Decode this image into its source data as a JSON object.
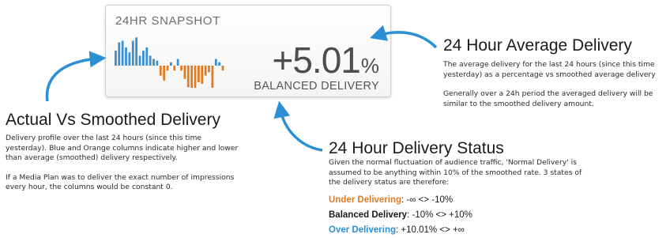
{
  "snapshot": {
    "title": "24HR SNAPSHOT",
    "value": "+5.01",
    "unit": "%",
    "status_label": "BALANCED DELIVERY"
  },
  "colors": {
    "higher": "#3b8fd0",
    "lower": "#e07b24",
    "arrow": "#2b8fd6"
  },
  "delivery_profile": {
    "deviations": [
      9,
      14,
      15,
      11,
      8,
      15,
      17,
      6,
      9,
      11,
      6,
      4,
      3,
      -6,
      -9,
      -3,
      2,
      -3,
      4,
      -3,
      -8,
      -13,
      -14,
      -17,
      -10,
      -11,
      -6,
      -4,
      -15,
      4,
      2,
      -3
    ]
  },
  "sections": {
    "actual": {
      "heading": "Actual Vs Smoothed Delivery",
      "paragraphs": [
        "Delivery profile over the last 24 hours (since this time yesterday). Blue and Orange columns indicate higher and lower than average (smoothed) delivery respectively.",
        "If a Media Plan was to deliver the exact number of impressions every hour, the columns would be constant 0."
      ]
    },
    "average": {
      "heading": "24 Hour Average Delivery",
      "paragraphs": [
        "The average delivery for the last 24 hours (since this time yesterday) as a percentage vs smoothed average delivery",
        "Generally over a 24h period the averaged delivery will be similar to the smoothed delivery amount."
      ]
    },
    "status": {
      "heading": "24 Hour Delivery Status",
      "paragraph": "Given the normal fluctuation of audience traffic, 'Normal Delivery' is assumed to be anything within 10% of the smoothed rate. 3 states of the delivery status are therefore:",
      "states": [
        {
          "name": "Under Delivering",
          "range": ": -∞ <> -10%"
        },
        {
          "name": "Balanced Delivery",
          "range": ": -10% <> +10%"
        },
        {
          "name": "Over Delivering",
          "range": ": +10.01% <> +∞"
        }
      ]
    }
  }
}
